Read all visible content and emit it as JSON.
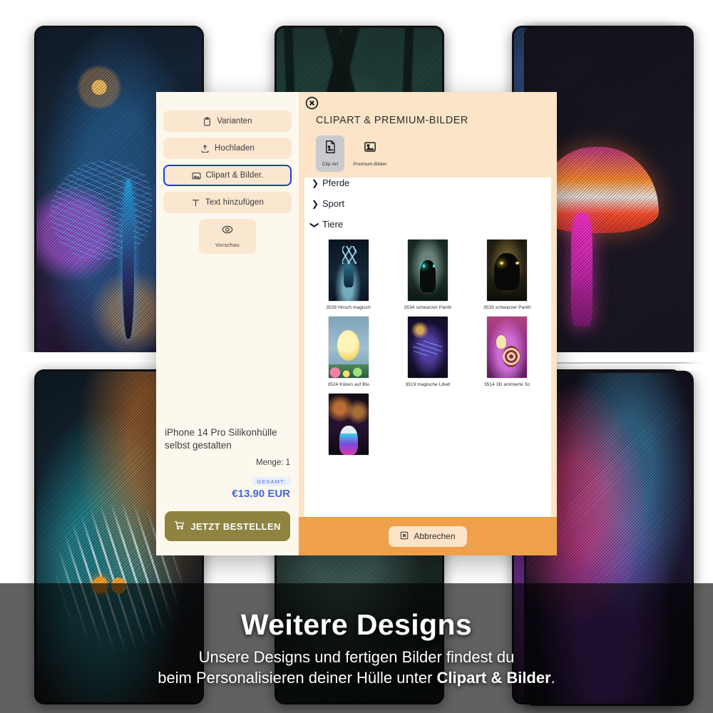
{
  "sidebar": {
    "tools": [
      {
        "label": "Varianten",
        "icon": "clipboard-icon",
        "active": false
      },
      {
        "label": "Hochladen",
        "icon": "upload-icon",
        "active": false
      },
      {
        "label": "Clipart & Bilder.",
        "icon": "image-icon",
        "active": true
      },
      {
        "label": "Text hinzufügen",
        "icon": "text-icon",
        "active": false
      }
    ],
    "preview": {
      "label": "Vorschau",
      "icon": "eye-icon"
    },
    "product": {
      "title": "iPhone 14 Pro Silikonhülle selbst gestalten",
      "quantity_label": "Menge: 1",
      "total_label": "GESAMT:",
      "total_value": "€13.90 EUR"
    },
    "order_button": {
      "label": "JETZT BESTELLEN",
      "icon": "cart-icon"
    }
  },
  "clipart_modal": {
    "close_icon": "close-circle-icon",
    "title": "CLIPART & PREMIUM-BILDER",
    "tabs": [
      {
        "label": "Clip Art",
        "icon": "file-image-icon",
        "active": true
      },
      {
        "label": "Premium-Bilder",
        "icon": "picture-icon",
        "active": false
      }
    ],
    "categories": [
      {
        "label": "Pferde",
        "expanded": false
      },
      {
        "label": "Sport",
        "expanded": false
      },
      {
        "label": "Tiere",
        "expanded": true
      }
    ],
    "thumbnails": [
      {
        "caption": "3539 Hirsch magisch",
        "art": "th-deer"
      },
      {
        "caption": "3534 schwarzer Panth",
        "art": "th-panther1"
      },
      {
        "caption": "3533 schwarzer Panth",
        "art": "th-panther2"
      },
      {
        "caption": "3524 Küken auf Blu",
        "art": "th-chick"
      },
      {
        "caption": "3519 magische Libell",
        "art": "th-dragonfly2"
      },
      {
        "caption": "3514 3D animierte Sc",
        "art": "th-snail"
      }
    ],
    "partial_thumbnail": {
      "caption": "",
      "art": "th-bird"
    },
    "cancel_button": {
      "label": "Abbrechen",
      "icon": "close-box-icon"
    }
  },
  "banner": {
    "title": "Weitere Designs",
    "line1": "Unsere Designs und fertigen Bilder findest du",
    "line2_prefix": "beim Personalisieren deiner Hülle unter ",
    "line2_highlight": "Clipart & Bilder",
    "line2_suffix": "."
  },
  "colors": {
    "accent_orange": "#f0a04b",
    "panel_peach": "#fbe4c7",
    "sidebar_cream": "#fdf8ee",
    "button_olive": "#8e8440",
    "price_blue": "#4468d8",
    "focus_blue": "#1a3fd6"
  }
}
